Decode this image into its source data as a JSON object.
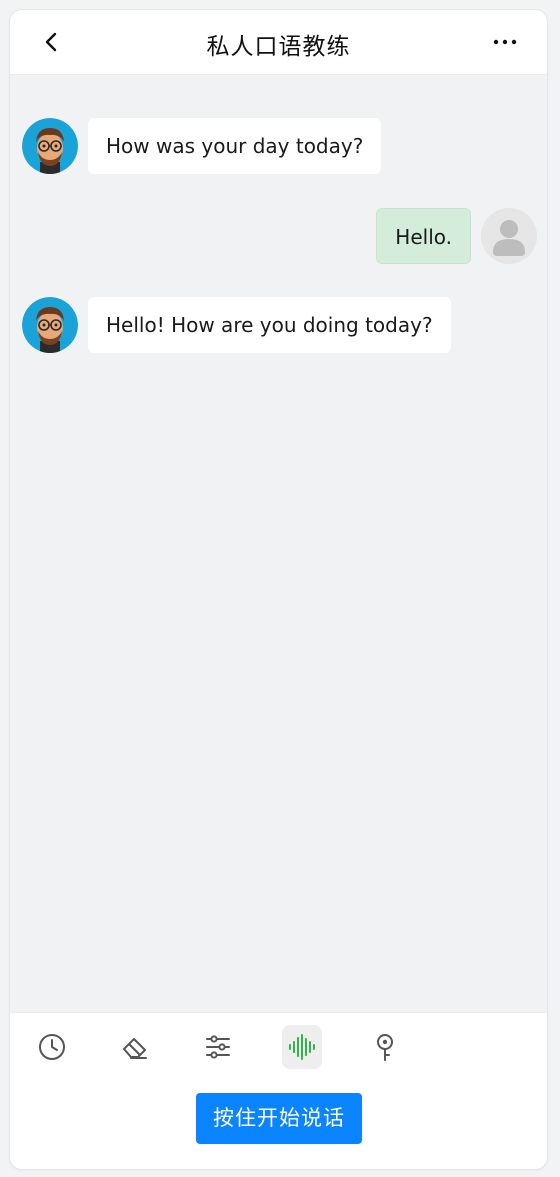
{
  "header": {
    "title": "私人口语教练",
    "back_icon": "chevron-left-icon",
    "more_icon": "more-horizontal-icon"
  },
  "messages": [
    {
      "role": "assistant",
      "text": "How was your day today?"
    },
    {
      "role": "user",
      "text": "Hello."
    },
    {
      "role": "assistant",
      "text": "Hello! How are you doing today?"
    }
  ],
  "toolbar": {
    "tools": [
      {
        "icon": "clock-icon",
        "active": false
      },
      {
        "icon": "eraser-icon",
        "active": false
      },
      {
        "icon": "sliders-icon",
        "active": false
      },
      {
        "icon": "voice-wave-icon",
        "active": true
      },
      {
        "icon": "pin-icon",
        "active": false
      }
    ],
    "talk_label": "按住开始说话"
  },
  "colors": {
    "accent": "#0a84ff",
    "user_bubble": "#d4ecda",
    "voice_active": "#2fb34a"
  }
}
